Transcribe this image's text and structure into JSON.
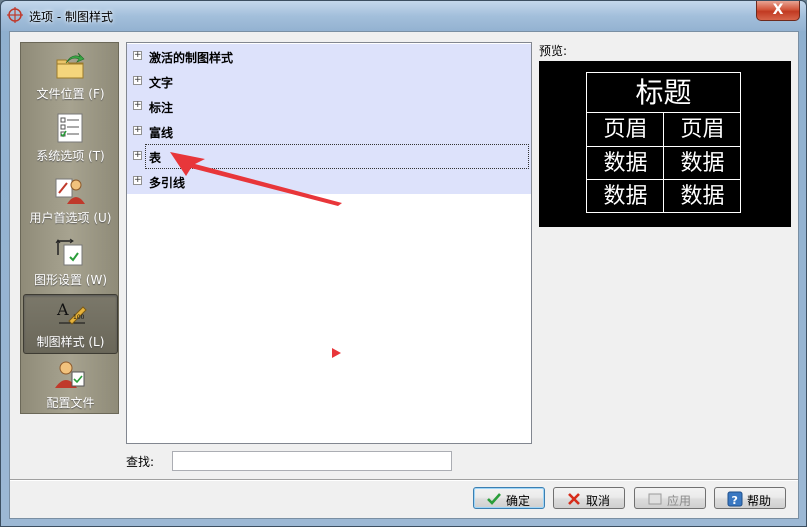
{
  "window": {
    "title": "选项 - 制图样式",
    "close_glyph": "X"
  },
  "nav": {
    "items": [
      {
        "label": "文件位置 (F)",
        "icon": "folder-arrow-icon"
      },
      {
        "label": "系统选项 (T)",
        "icon": "checklist-icon"
      },
      {
        "label": "用户首选项 (U)",
        "icon": "user-preferences-icon"
      },
      {
        "label": "图形设置 (W)",
        "icon": "graphics-settings-icon"
      },
      {
        "label": "制图样式 (L)",
        "icon": "drafting-style-icon",
        "selected": true
      },
      {
        "label": "配置文件",
        "icon": "profile-icon"
      }
    ]
  },
  "tree": {
    "items": [
      {
        "label": "激活的制图样式",
        "expander": "+"
      },
      {
        "label": "文字",
        "expander": "+"
      },
      {
        "label": "标注",
        "expander": "+"
      },
      {
        "label": "富线",
        "expander": "+"
      },
      {
        "label": "表",
        "expander": "+",
        "focused": true
      },
      {
        "label": "多引线",
        "expander": "+"
      }
    ]
  },
  "preview": {
    "label": "预览:",
    "title": "标题",
    "header": [
      "页眉",
      "页眉"
    ],
    "rows": [
      [
        "数据",
        "数据"
      ],
      [
        "数据",
        "数据"
      ]
    ]
  },
  "search": {
    "label": "查找:",
    "value": ""
  },
  "buttons": {
    "ok": "确定",
    "cancel": "取消",
    "apply": "应用",
    "help": "帮助"
  },
  "colors": {
    "accent_arrow": "#e8363a",
    "nav_bg": "#a7a390",
    "tree_row_bg": "#dde2fb"
  }
}
